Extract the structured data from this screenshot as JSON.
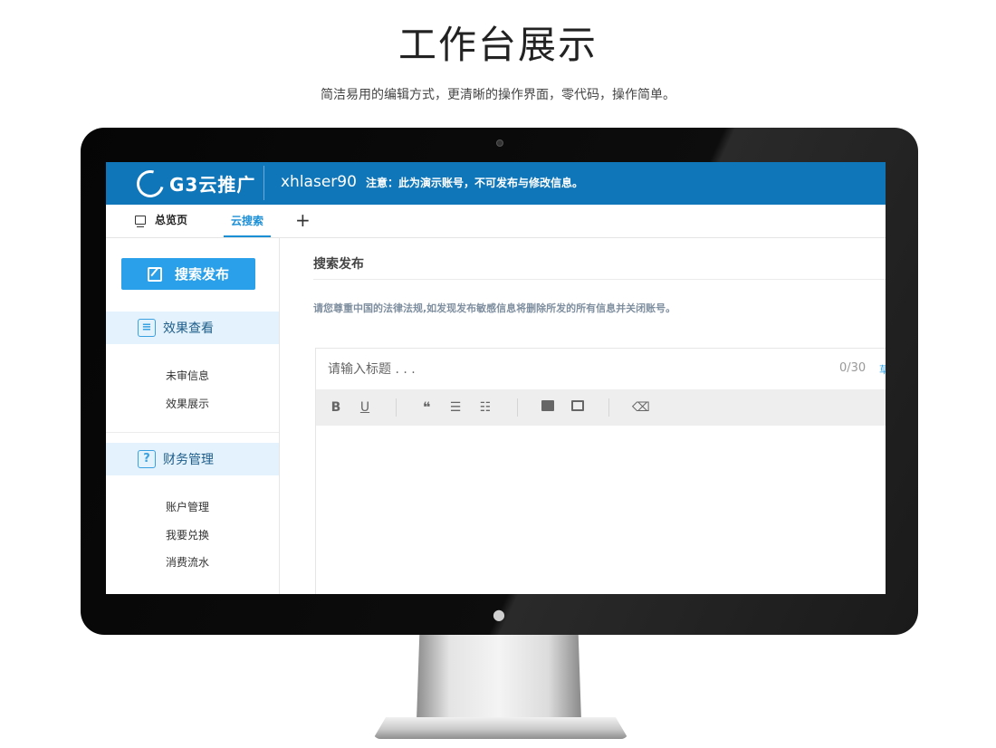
{
  "page": {
    "title": "工作台展示",
    "subtitle": "简洁易用的编辑方式，更清晰的操作界面，零代码，操作简单。"
  },
  "header": {
    "brand": "G3云推广",
    "username": "xhlaser90",
    "notice": "注意：此为演示账号，不可发布与修改信息。",
    "accent_color": "#0f76b9"
  },
  "tabs": [
    {
      "label": "总览页",
      "icon": "monitor-icon",
      "active": false
    },
    {
      "label": "云搜索",
      "active": true
    },
    {
      "label": "+"
    }
  ],
  "sidebar": {
    "publish_button": "搜索发布",
    "sections": [
      {
        "label": "效果查看",
        "icon": "document-search-icon",
        "items": [
          "未审信息",
          "效果展示"
        ]
      },
      {
        "label": "财务管理",
        "icon": "question-icon",
        "icon_glyph": "?",
        "items": [
          "账户管理",
          "我要兑换",
          "消费流水"
        ]
      }
    ]
  },
  "main": {
    "title": "搜索发布",
    "law_notice": "请您尊重中国的法律法规,如发现发布敏感信息将删除所发的所有信息并关闭账号。",
    "editor": {
      "title_placeholder": "请输入标题 . . .",
      "char_count": "0/30",
      "count_extra": "草",
      "toolbar": {
        "bold": "B",
        "underline": "U",
        "quote": "❝",
        "unordered_list": "☰",
        "ordered_list": "☷",
        "clear": "⌫"
      }
    }
  }
}
